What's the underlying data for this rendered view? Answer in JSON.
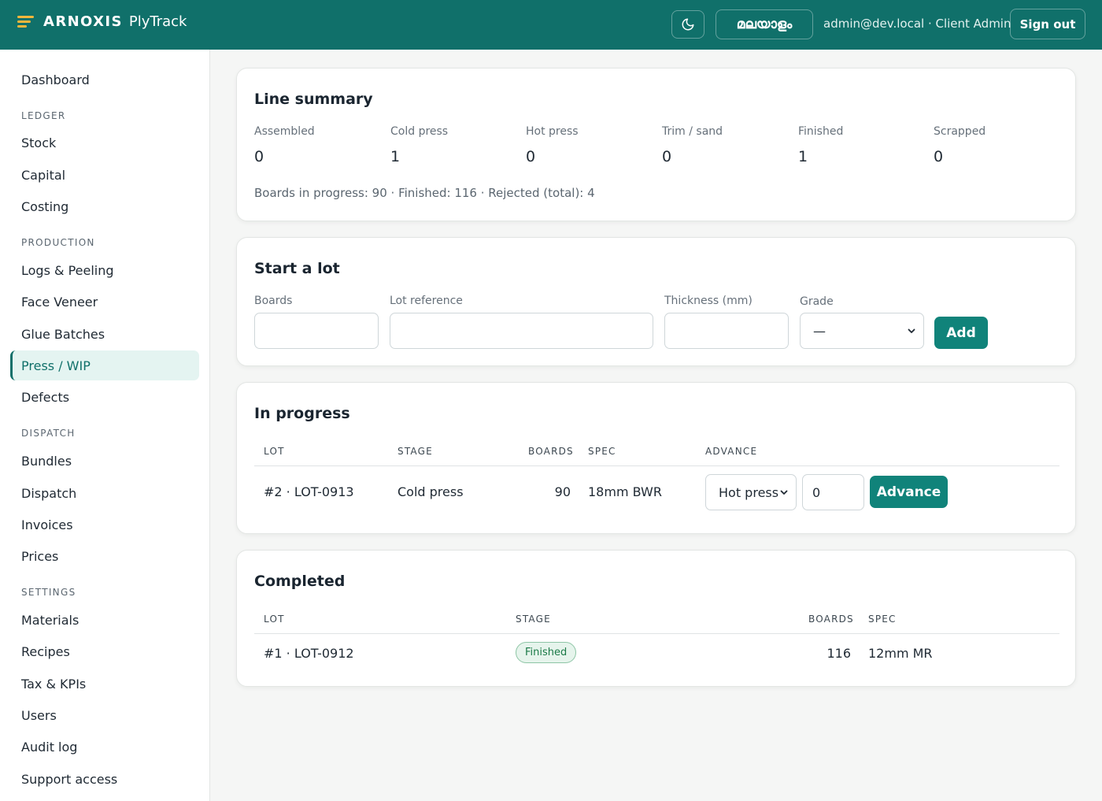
{
  "header": {
    "brand_name": "ARNOXIS",
    "brand_sub": "PlyTrack",
    "language": "മലയാളം",
    "user": "admin@dev.local · Client Admin",
    "sign_out": "Sign out"
  },
  "sidebar": {
    "dashboard": "Dashboard",
    "sections": {
      "ledger": "LEDGER",
      "production": "PRODUCTION",
      "dispatch": "DISPATCH",
      "settings": "SETTINGS"
    },
    "items": {
      "stock": "Stock",
      "capital": "Capital",
      "costing": "Costing",
      "logs": "Logs & Peeling",
      "face_veneer": "Face Veneer",
      "glue": "Glue Batches",
      "press": "Press / WIP",
      "defects": "Defects",
      "bundles": "Bundles",
      "dispatch": "Dispatch",
      "invoices": "Invoices",
      "prices": "Prices",
      "materials": "Materials",
      "recipes": "Recipes",
      "tax": "Tax & KPIs",
      "users": "Users",
      "audit": "Audit log",
      "support": "Support access"
    }
  },
  "summary": {
    "title": "Line summary",
    "stats": [
      {
        "label": "Assembled",
        "value": "0"
      },
      {
        "label": "Cold press",
        "value": "1"
      },
      {
        "label": "Hot press",
        "value": "0"
      },
      {
        "label": "Trim / sand",
        "value": "0"
      },
      {
        "label": "Finished",
        "value": "1"
      },
      {
        "label": "Scrapped",
        "value": "0"
      }
    ],
    "line": "Boards in progress: 90 · Finished: 116 · Rejected (total): 4"
  },
  "start_lot": {
    "title": "Start a lot",
    "boards_label": "Boards",
    "lot_ref_label": "Lot reference",
    "thickness_label": "Thickness (mm)",
    "grade_label": "Grade",
    "grade_value": "—",
    "add": "Add"
  },
  "in_progress": {
    "title": "In progress",
    "headers": {
      "lot": "LOT",
      "stage": "STAGE",
      "boards": "BOARDS",
      "spec": "SPEC",
      "advance": "ADVANCE"
    },
    "row": {
      "lot": "#2 · LOT-0913",
      "stage": "Cold press",
      "boards": "90",
      "spec": "18mm BWR",
      "next_stage": "Hot press",
      "qty": "0",
      "advance": "Advance"
    }
  },
  "completed": {
    "title": "Completed",
    "headers": {
      "lot": "LOT",
      "stage": "STAGE",
      "boards": "BOARDS",
      "spec": "SPEC"
    },
    "row": {
      "lot": "#1 · LOT-0912",
      "stage": "Finished",
      "boards": "116",
      "spec": "12mm MR"
    }
  },
  "colors": {
    "accent": "#10706a",
    "button": "#10837a",
    "highlight": "#f5b73b"
  }
}
